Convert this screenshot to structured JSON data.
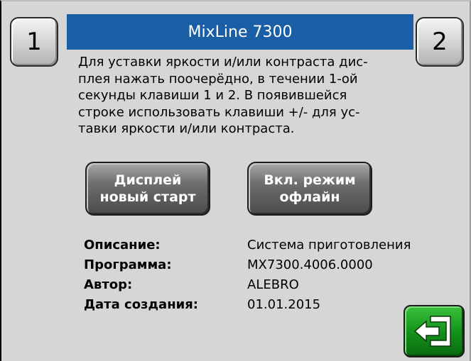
{
  "header": {
    "title": "MixLine 7300",
    "key1_label": "1",
    "key2_label": "2"
  },
  "description": "Для уставки яркости и/или контраста дис-\nплея нажать поочерёдно, в течении 1-ой\nсекунды клавиши 1 и 2. В появившейся\nстроке использовать клавиши +/- для ус-\nтавки яркости и/или контраста.",
  "buttons": {
    "restart_label": "Дисплей\nновый старт",
    "offline_label": "Вкл. режим\nофлайн"
  },
  "info": [
    {
      "label": "Описание:",
      "value": "Система приготовления"
    },
    {
      "label": "Программа:",
      "value": "MX7300.4006.0000"
    },
    {
      "label": "Автор:",
      "value": "ALEBRO"
    },
    {
      "label": "Дата создания:",
      "value": "01.01.2015"
    }
  ],
  "exit": {
    "icon": "exit-door-arrow-icon",
    "color": "#12901a"
  },
  "colors": {
    "title_bar": "#1a5ea6",
    "background": "#d6d6d6"
  }
}
